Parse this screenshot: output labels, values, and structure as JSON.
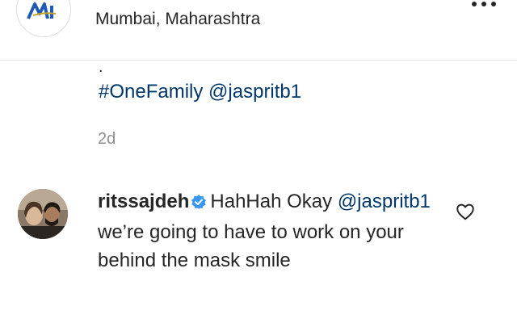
{
  "post": {
    "account_logo_icon": "mumbai-indians-logo",
    "location": "Mumbai, Maharashtra",
    "more_icon": "more-options-icon",
    "caption_dot": ".",
    "hashtag": "#OneFamily",
    "mention": "@jaspritb1",
    "timestamp": "2d"
  },
  "comment": {
    "avatar_icon": "user-avatar",
    "username": "ritssajdeh",
    "verified_icon": "verified-badge-icon",
    "text_start": "HahHah Okay",
    "mention": "@jaspritb1",
    "text_end": "we’re going to have to work on your behind the mask smile",
    "like_icon": "heart-icon"
  },
  "colors": {
    "link": "#00376b",
    "verified": "#3897f0",
    "text": "#262626",
    "muted": "#8e8e8e"
  }
}
